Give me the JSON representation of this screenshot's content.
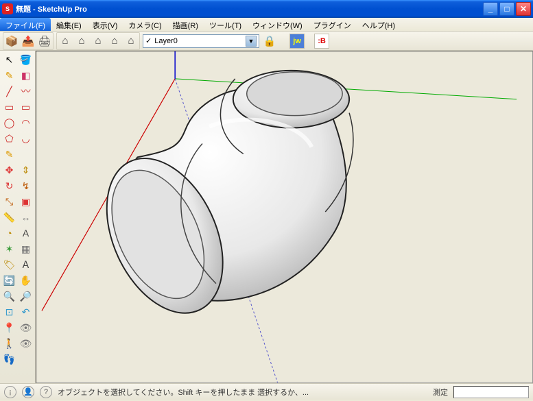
{
  "window": {
    "title": "無題 - SketchUp Pro"
  },
  "menu": {
    "file": "ファイル(F)",
    "edit": "編集(E)",
    "view": "表示(V)",
    "camera": "カメラ(C)",
    "draw": "描画(R)",
    "tools": "ツール(T)",
    "window": "ウィンドウ(W)",
    "plugins": "プラグイン",
    "help": "ヘルプ(H)"
  },
  "toolbar": {
    "layer_selected": "Layer0",
    "jw_label": "jw",
    "ib_label": ":B"
  },
  "status": {
    "hint": "オブジェクトを選択してください。Shift キーを押したまま 選択するか、...",
    "measure_label": "測定",
    "measure_value": ""
  },
  "icons": {
    "model_open": "📦",
    "model_send": "📤",
    "model_print": "🖨",
    "home": "⌂",
    "house2": "⌂",
    "house3": "⌂",
    "house4": "⌂",
    "house5": "⌂",
    "lock": "🔒",
    "select": "↖",
    "paint": "🪣",
    "pencil": "✎",
    "eraser": "◧",
    "line": "╱",
    "freehand": "〰",
    "rect": "▭",
    "rectr": "▭",
    "circle": "◯",
    "arc": "◠",
    "poly": "⬠",
    "arc2": "◡",
    "pencil2": "✎",
    "move": "✥",
    "rot": "↻",
    "pushpull": "⇕",
    "follow": "↯",
    "scale": "⤡",
    "offset": "▣",
    "tape": "📏",
    "dim": "↔",
    "protr": "◔",
    "text": "A",
    "axes": "✶",
    "section": "▦",
    "label": "🏷",
    "3dtext": "Ａ",
    "orbit": "🔄",
    "pan": "✋",
    "zoom": "🔍",
    "zoomw": "🔎",
    "zoomext": "⊡",
    "prev": "↶",
    "posn": "📍",
    "look": "👁",
    "walk": "🚶",
    "eye": "👁",
    "feet": "👣"
  }
}
